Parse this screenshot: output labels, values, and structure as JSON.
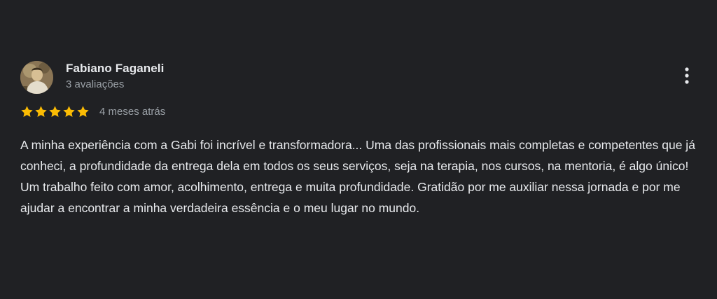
{
  "review": {
    "author_name": "Fabiano Faganeli",
    "author_review_count": "3 avaliações",
    "rating": 5,
    "rating_max": 5,
    "date": "4 meses atrás",
    "text": "A minha experiência com a Gabi foi incrível e transformadora... Uma das profissionais mais completas e competentes que já conheci, a profundidade da entrega dela em todos os seus serviços, seja na terapia, nos cursos, na mentoria, é algo único! Um trabalho feito com amor, acolhimento, entrega e muita profundidade. Gratidão por me auxiliar nessa jornada e por me ajudar a encontrar a minha verdadeira essência e o meu lugar no mundo."
  },
  "icons": {
    "star": "star-icon",
    "more": "more-vert-icon"
  },
  "colors": {
    "background": "#202124",
    "star": "#fbbc04",
    "text_primary": "#e8eaed",
    "text_secondary": "#9aa0a6"
  }
}
